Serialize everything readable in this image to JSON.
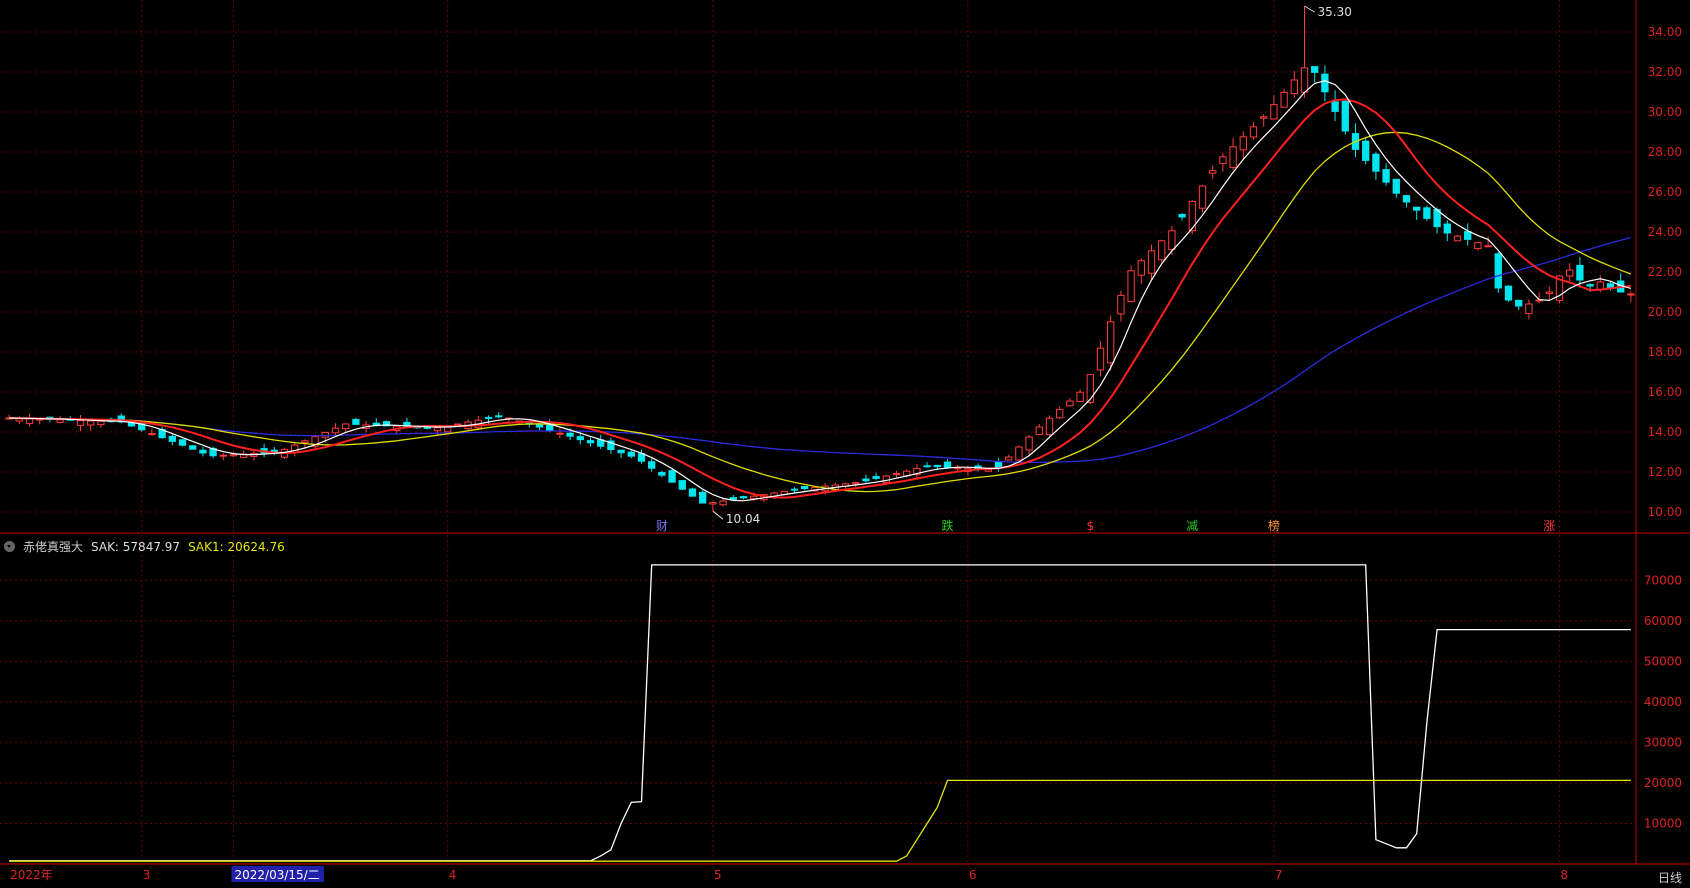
{
  "indicator": {
    "name": "赤佬真强大",
    "sak_label": "SAK: 57847.97",
    "sak1_label": "SAK1: 20624.76",
    "sak_color": "#ffffff",
    "sak1_color": "#e6e600"
  },
  "period_label": "日线",
  "price_annotations": {
    "high": "35.30",
    "low": "10.04"
  },
  "event_markers": [
    {
      "label": "财",
      "color": "#7777ff",
      "day": 0
    },
    {
      "label": "跌",
      "color": "#22cc22",
      "day": 0
    },
    {
      "label": "$",
      "color": "#ff3333",
      "day": 0
    },
    {
      "label": "减",
      "color": "#22cc22",
      "day": 0
    },
    {
      "label": "榜",
      "color": "#ff9933",
      "day": 0
    },
    {
      "label": "涨",
      "color": "#ff3333",
      "day": 0
    }
  ],
  "x_labels": [
    {
      "label": "2022年",
      "day": 0,
      "selected": false
    },
    {
      "label": "3",
      "day": 13,
      "selected": false
    },
    {
      "label": "2022/03/15/二",
      "day": 22,
      "selected": true
    },
    {
      "label": "4",
      "day": 43,
      "selected": false
    },
    {
      "label": "5",
      "day": 69,
      "selected": false
    },
    {
      "label": "6",
      "day": 94,
      "selected": false
    },
    {
      "label": "7",
      "day": 124,
      "selected": false
    },
    {
      "label": "8",
      "day": 152,
      "selected": false
    }
  ],
  "colors": {
    "up": "#ff3c3c",
    "down": "#00e5ee",
    "ma5": "#ffffff",
    "ma10": "#ff2020",
    "ma20": "#dddd00",
    "ma60": "#2b2bdd",
    "grid": "#6a0000",
    "axis": "#cc0000"
  },
  "chart_data": [
    {
      "type": "candlestick",
      "title": "",
      "ylim": [
        9,
        35.6
      ],
      "yticks": [
        10.0,
        12.0,
        14.0,
        16.0,
        18.0,
        20.0,
        22.0,
        24.0,
        26.0,
        28.0,
        30.0,
        32.0,
        34.0
      ],
      "series_lines": [
        "MA5",
        "MA10",
        "MA20",
        "MA60"
      ],
      "candles": [],
      "ma5": [],
      "ma10": [],
      "ma20": [],
      "ma60": []
    },
    {
      "type": "line",
      "title": "",
      "ylim": [
        0,
        76000
      ],
      "yticks": [
        10000,
        20000,
        30000,
        40000,
        50000,
        60000,
        70000
      ],
      "series": [
        {
          "name": "SAK",
          "values": []
        },
        {
          "name": "SAK1",
          "values": []
        }
      ]
    }
  ]
}
